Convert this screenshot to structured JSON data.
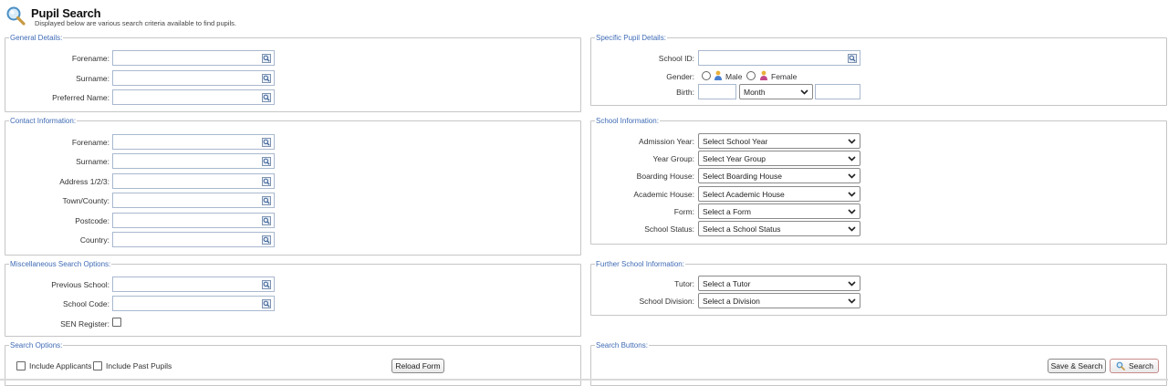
{
  "header": {
    "title": "Pupil Search",
    "subtitle": "Displayed below are various search criteria available to find pupils."
  },
  "general": {
    "legend": "General Details:",
    "forename_label": "Forename:",
    "surname_label": "Surname:",
    "preferred_label": "Preferred Name:"
  },
  "contact": {
    "legend": "Contact Information:",
    "forename_label": "Forename:",
    "surname_label": "Surname:",
    "address_label": "Address 1/2/3:",
    "town_label": "Town/County:",
    "postcode_label": "Postcode:",
    "country_label": "Country:"
  },
  "misc": {
    "legend": "Miscellaneous Search Options:",
    "previous_school_label": "Previous School:",
    "school_code_label": "School Code:",
    "sen_label": "SEN Register:"
  },
  "search_options": {
    "legend": "Search Options:",
    "include_applicants": "Include Applicants",
    "include_past": "Include Past Pupils",
    "reload": "Reload Form"
  },
  "specific": {
    "legend": "Specific Pupil Details:",
    "school_id_label": "School ID:",
    "gender_label": "Gender:",
    "male": "Male",
    "female": "Female",
    "birth_label": "Birth:",
    "month": "Month"
  },
  "school": {
    "legend": "School Information:",
    "admission_label": "Admission Year:",
    "admission_value": "Select School Year",
    "yeargroup_label": "Year Group:",
    "yeargroup_value": "Select Year Group",
    "boarding_label": "Boarding House:",
    "boarding_value": "Select Boarding House",
    "academic_label": "Academic House:",
    "academic_value": "Select Academic House",
    "form_label": "Form:",
    "form_value": "Select a Form",
    "status_label": "School Status:",
    "status_value": "Select a School Status"
  },
  "further": {
    "legend": "Further School Information:",
    "tutor_label": "Tutor:",
    "tutor_value": "Select a Tutor",
    "division_label": "School Division:",
    "division_value": "Select a Division"
  },
  "buttons": {
    "legend": "Search Buttons:",
    "save_search": "Save & Search",
    "search": "Search"
  },
  "icons": {
    "header": "magnifier-icon",
    "lookup": "lookup-icon",
    "male": "male-user-icon",
    "female": "female-user-icon",
    "search_button": "search-icon"
  },
  "colors": {
    "legend": "#3f6bb5",
    "input_border": "#a9b8cf",
    "fieldset_border": "#c6c6c6"
  }
}
